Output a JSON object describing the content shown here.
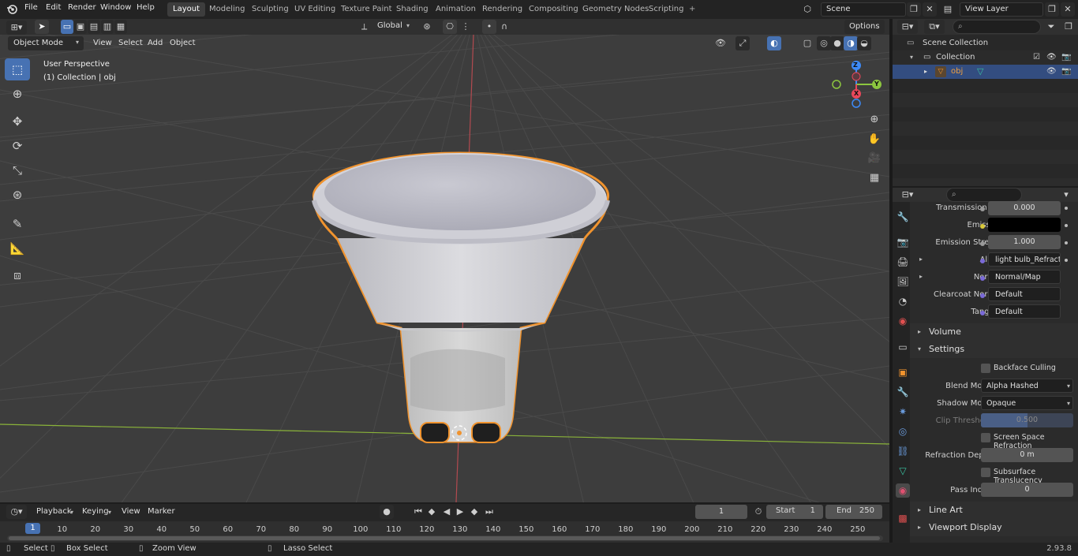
{
  "topbar": {
    "menus": [
      "File",
      "Edit",
      "Render",
      "Window",
      "Help"
    ],
    "workspaces": [
      "Layout",
      "Modeling",
      "Sculpting",
      "UV Editing",
      "Texture Paint",
      "Shading",
      "Animation",
      "Rendering",
      "Compositing",
      "Geometry Nodes",
      "Scripting"
    ],
    "active_workspace": "Layout",
    "add_tab_label": "+",
    "scene": "Scene",
    "view_layer": "View Layer"
  },
  "viewport_header": {
    "mode": "Object Mode",
    "menus": [
      "View",
      "Select",
      "Add",
      "Object"
    ],
    "orientation": "Global",
    "options_label": "Options"
  },
  "viewport": {
    "perspective_label": "User Perspective",
    "collection_label": "(1) Collection | obj",
    "gizmo_axes": {
      "x": "X",
      "y": "Y",
      "z": "Z"
    }
  },
  "outliner": {
    "items": [
      {
        "label": "Scene Collection"
      },
      {
        "label": "Collection"
      },
      {
        "label": "obj"
      }
    ]
  },
  "properties": {
    "rows": [
      {
        "label": "Transmission R...",
        "value": "0.000"
      },
      {
        "label": "Emission",
        "value": ""
      },
      {
        "label": "Emission Strengt",
        "value": "1.000"
      },
      {
        "label": "Alpha",
        "value": "light bulb_Refract_in..."
      },
      {
        "label": "Normal",
        "value": "Normal/Map"
      },
      {
        "label": "Clearcoat Normal",
        "value": "Default"
      },
      {
        "label": "Tangent",
        "value": "Default"
      }
    ],
    "sections": {
      "volume": "Volume",
      "settings": "Settings",
      "line_art": "Line Art",
      "viewport_display": "Viewport Display"
    },
    "settings": {
      "backface_culling": "Backface Culling",
      "blend_mode_label": "Blend Mode",
      "blend_mode": "Alpha Hashed",
      "shadow_mode_label": "Shadow Mode",
      "shadow_mode": "Opaque",
      "clip_threshold_label": "Clip Threshold",
      "clip_threshold": "0.500",
      "screen_space_refraction": "Screen Space Refraction",
      "refraction_depth_label": "Refraction Depth",
      "refraction_depth": "0 m",
      "subsurface_translucency": "Subsurface Translucency",
      "pass_index_label": "Pass Index",
      "pass_index": "0"
    }
  },
  "timeline": {
    "menus": [
      "Playback",
      "Keying",
      "View",
      "Marker"
    ],
    "current_frame": "1",
    "start_label": "Start",
    "start": "1",
    "end_label": "End",
    "end": "250",
    "ticks": [
      "10",
      "20",
      "30",
      "40",
      "50",
      "60",
      "70",
      "80",
      "90",
      "100",
      "110",
      "120",
      "130",
      "140",
      "150",
      "160",
      "170",
      "180",
      "190",
      "200",
      "210",
      "220",
      "230",
      "240",
      "250"
    ],
    "playhead_label": "1"
  },
  "statusbar": {
    "select": "Select",
    "box_select": "Box Select",
    "zoom_view": "Zoom View",
    "lasso_select": "Lasso Select",
    "version": "2.93.8"
  },
  "colors": {
    "accent": "#4772b3",
    "selection_outline": "#f0932e",
    "axis_x": "#e8475a",
    "axis_y": "#8cc63f",
    "axis_z": "#3d8af7"
  }
}
